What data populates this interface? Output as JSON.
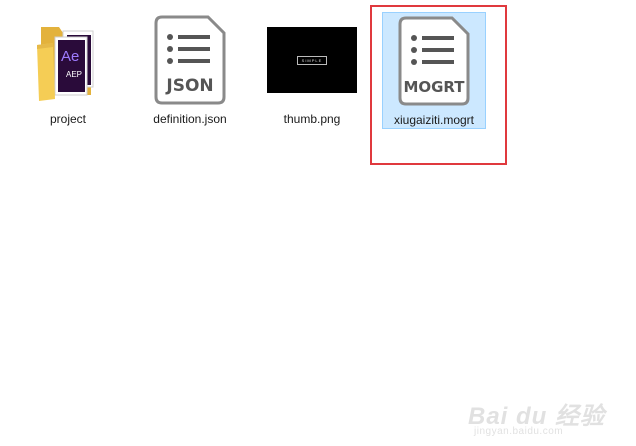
{
  "files": [
    {
      "name": "project",
      "icon": "aep-folder-icon"
    },
    {
      "name": "definition.json",
      "icon": "json-file-icon",
      "badge": "JSON"
    },
    {
      "name": "thumb.png",
      "icon": "png-thumbnail",
      "thumb_text": "SIMPLE"
    },
    {
      "name": "xiugaiziti.mogrt",
      "icon": "mogrt-file-icon",
      "badge": "MOGRT",
      "selected": true
    }
  ],
  "folder_badge": {
    "ae": "Ae",
    "aep": "AEP"
  },
  "watermark": {
    "main": "Bai du 经验",
    "sub": "jingyan.baidu.com"
  },
  "colors": {
    "highlight_border": "#e0393e",
    "selection_fill": "#cce8ff",
    "ae_purple": "#2a0b3a",
    "ae_text": "#9f7bff",
    "folder_yellow": "#f5cd55"
  }
}
